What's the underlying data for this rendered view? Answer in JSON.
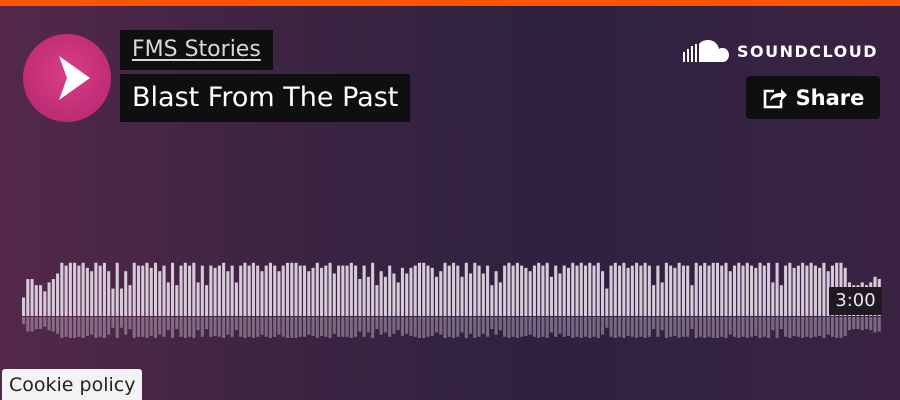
{
  "track": {
    "artist": "FMS Stories",
    "title": "Blast From The Past",
    "duration": "3:00"
  },
  "brand": {
    "name": "SOUNDCLOUD",
    "icon": "soundcloud-cloud-icon"
  },
  "share": {
    "label": "Share",
    "icon": "share-icon"
  },
  "play": {
    "icon": "play-icon"
  },
  "cookie": {
    "label": "Cookie policy"
  },
  "colors": {
    "accent": "#ff5500",
    "play_button": "#c93079",
    "label_background": "#0f0f11",
    "waveform_bar": "#d8cbd9"
  },
  "waveform": {
    "levels": [
      0.33,
      0.66,
      0.66,
      0.55,
      0.55,
      0.44,
      0.6,
      0.66,
      0.76,
      0.95,
      0.9,
      0.95,
      0.95,
      0.9,
      0.95,
      0.86,
      0.8,
      0.95,
      0.9,
      0.95,
      0.8,
      0.49,
      0.95,
      0.49,
      0.8,
      0.55,
      0.95,
      0.9,
      0.9,
      0.95,
      0.86,
      0.95,
      0.8,
      0.9,
      0.6,
      0.95,
      0.55,
      0.9,
      0.95,
      0.9,
      0.95,
      0.6,
      0.9,
      0.55,
      0.9,
      0.86,
      0.9,
      0.95,
      0.8,
      0.9,
      0.6,
      0.9,
      0.95,
      0.9,
      0.95,
      0.9,
      0.8,
      0.9,
      0.95,
      0.9,
      0.8,
      0.9,
      0.95,
      0.95,
      0.95,
      0.9,
      0.9,
      0.8,
      0.86,
      0.95,
      0.86,
      0.9,
      0.95,
      0.76,
      0.9,
      0.9,
      0.9,
      0.95,
      0.9,
      0.66,
      0.9,
      0.7,
      0.95,
      0.55,
      0.8,
      0.7,
      0.9,
      0.76,
      0.6,
      0.86,
      0.76,
      0.86,
      0.9,
      0.95,
      0.95,
      0.9,
      0.86,
      0.7,
      0.8,
      0.95,
      0.9,
      0.95,
      0.9,
      0.7,
      0.95,
      0.76,
      0.95,
      0.9,
      0.76,
      0.9,
      0.55,
      0.8,
      0.6,
      0.9,
      0.95,
      0.9,
      0.95,
      0.9,
      0.86,
      0.8,
      0.9,
      0.95,
      0.9,
      0.95,
      0.7,
      0.9,
      0.76,
      0.9,
      0.86,
      0.95,
      0.9,
      0.95,
      0.9,
      0.95,
      0.9,
      0.95,
      0.8,
      0.49,
      0.9,
      0.95,
      0.9,
      0.95,
      0.86,
      0.9,
      0.95,
      0.9,
      0.95,
      0.9,
      0.55,
      0.9,
      0.6,
      0.95,
      0.9,
      0.86,
      0.95,
      0.9,
      0.9,
      0.55,
      0.95,
      0.9,
      0.95,
      0.9,
      0.95,
      0.95,
      0.9,
      0.95,
      0.8,
      0.9,
      0.95,
      0.9,
      0.95,
      0.9,
      0.86,
      0.95,
      0.9,
      0.95,
      0.6,
      0.95,
      0.55,
      0.9,
      0.95,
      0.86,
      0.9,
      0.95,
      0.9,
      0.95,
      0.9,
      0.86,
      0.95,
      0.8,
      0.9,
      0.95,
      0.95,
      0.86,
      0.6,
      0.55,
      0.55,
      0.6,
      0.55,
      0.6,
      0.7,
      0.66
    ]
  }
}
